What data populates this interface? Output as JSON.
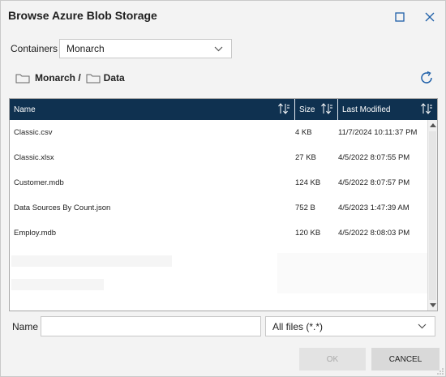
{
  "dialog": {
    "title": "Browse Azure Blob Storage"
  },
  "containers": {
    "label": "Containers",
    "selected": "Monarch"
  },
  "breadcrumb": {
    "root": "Monarch /",
    "current": "Data"
  },
  "grid": {
    "columns": [
      "Name",
      "Size",
      "Last Modified"
    ],
    "rows": [
      {
        "name": "Classic.csv",
        "size": "4 KB",
        "modified": "11/7/2024 10:11:37 PM"
      },
      {
        "name": "Classic.xlsx",
        "size": "27 KB",
        "modified": "4/5/2022 8:07:55 PM"
      },
      {
        "name": "Customer.mdb",
        "size": "124 KB",
        "modified": "4/5/2022 8:07:57 PM"
      },
      {
        "name": "Data Sources By Count.json",
        "size": "752 B",
        "modified": "4/5/2023 1:47:39 AM"
      },
      {
        "name": "Employ.mdb",
        "size": "120 KB",
        "modified": "4/5/2022 8:08:03 PM"
      }
    ]
  },
  "footer": {
    "name_label": "Name",
    "name_value": "",
    "filter": "All files (*.*)",
    "ok_label": "OK",
    "cancel_label": "CANCEL"
  },
  "colors": {
    "header_bg": "#0f3150",
    "accent": "#1e5fa8"
  }
}
